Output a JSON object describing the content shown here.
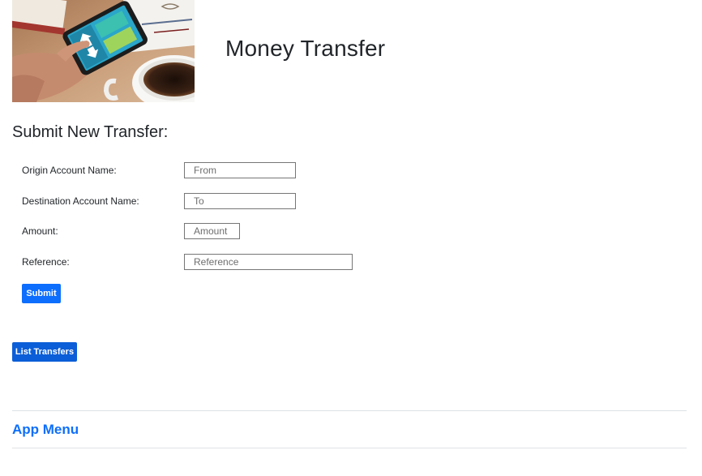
{
  "header": {
    "title": "Money Transfer"
  },
  "form": {
    "heading": "Submit New Transfer:",
    "fields": [
      {
        "label": "Origin Account Name:",
        "placeholder": "From",
        "value": ""
      },
      {
        "label": "Destination Account Name:",
        "placeholder": "To",
        "value": ""
      },
      {
        "label": "Amount:",
        "placeholder": "Amount",
        "value": ""
      },
      {
        "label": "Reference:",
        "placeholder": "Reference",
        "value": ""
      }
    ],
    "submit_label": "Submit"
  },
  "actions": {
    "list_transfers_label": "List Transfers"
  },
  "footer": {
    "app_menu_label": "App Menu"
  },
  "colors": {
    "primary": "#0d6efd",
    "primary_dark": "#0b5ed7",
    "text": "#212529",
    "divider": "#dee2e6"
  }
}
